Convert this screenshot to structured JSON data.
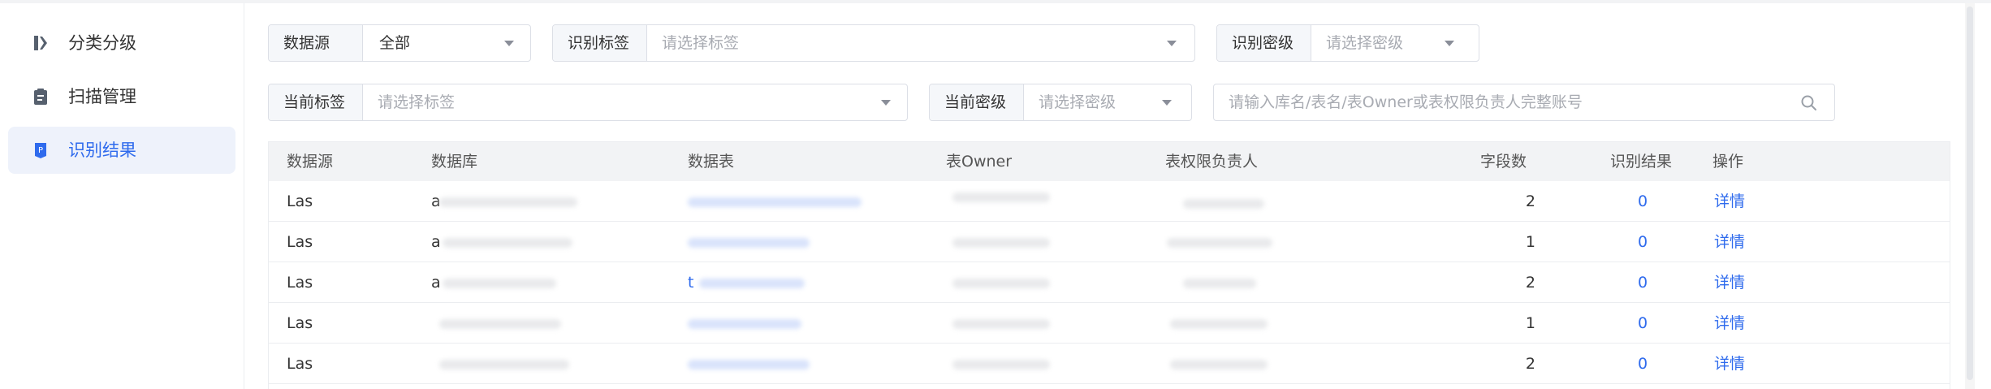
{
  "sidebar": {
    "items": [
      {
        "label": "分类分级",
        "icon": "tag-icon",
        "active": false
      },
      {
        "label": "扫描管理",
        "icon": "clipboard-icon",
        "active": false
      },
      {
        "label": "识别结果",
        "icon": "result-icon",
        "active": true
      }
    ]
  },
  "filters": {
    "datasource": {
      "label": "数据源",
      "value": "全部"
    },
    "recognized_tag": {
      "label": "识别标签",
      "placeholder": "请选择标签"
    },
    "recognized_level": {
      "label": "识别密级",
      "placeholder": "请选择密级"
    },
    "current_tag": {
      "label": "当前标签",
      "placeholder": "请选择标签"
    },
    "current_level": {
      "label": "当前密级",
      "placeholder": "请选择密级"
    },
    "search": {
      "placeholder": "请输入库名/表名/表Owner或表权限负责人完整账号"
    }
  },
  "table": {
    "columns": [
      "数据源",
      "数据库",
      "数据表",
      "表Owner",
      "表权限负责人",
      "字段数",
      "识别结果",
      "操作"
    ],
    "rows": [
      {
        "source": "Las",
        "db_prefix": "a",
        "table_prefix": "",
        "owner_prefix": "",
        "field_count": "2",
        "result": "0",
        "action": "详情"
      },
      {
        "source": "Las",
        "db_prefix": "a",
        "table_prefix": "",
        "owner_prefix": "",
        "field_count": "1",
        "result": "0",
        "action": "详情"
      },
      {
        "source": "Las",
        "db_prefix": "a",
        "table_prefix": "t",
        "owner_prefix": "",
        "field_count": "2",
        "result": "0",
        "action": "详情"
      },
      {
        "source": "Las",
        "db_prefix": "",
        "table_prefix": "",
        "owner_prefix": "",
        "field_count": "1",
        "result": "0",
        "action": "详情"
      },
      {
        "source": "Las",
        "db_prefix": "",
        "table_prefix": "",
        "owner_prefix": "",
        "field_count": "2",
        "result": "0",
        "action": "详情"
      }
    ]
  },
  "colors": {
    "accent": "#2f6bed",
    "header_bg": "#f2f3f5",
    "active_bg": "#eef2fb"
  }
}
